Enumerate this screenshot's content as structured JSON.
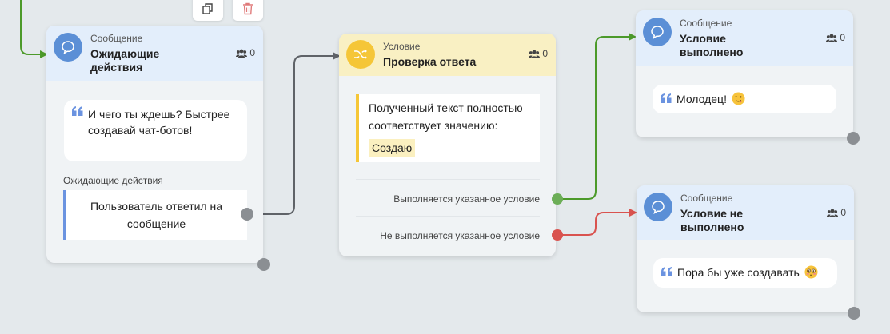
{
  "node_waiting": {
    "kind": "Сообщение",
    "title": "Ожидающие действия",
    "users": "0",
    "message": "И чего ты ждешь? Быстрее создавай чат-ботов!",
    "section_label": "Ожидающие действия",
    "action": "Пользователь ответил на сообщение"
  },
  "node_condition": {
    "kind": "Условие",
    "title": "Проверка ответа",
    "users": "0",
    "condition_text": "Полученный текст полностью соответствует значению:",
    "value": "Создаю",
    "branch_true": "Выполняется указанное условие",
    "branch_false": "Не выполняется указанное условие"
  },
  "node_success": {
    "kind": "Сообщение",
    "title": "Условие выполнено",
    "users": "0",
    "message": "Молодец!",
    "emoji": "winking-face-icon"
  },
  "node_fail": {
    "kind": "Сообщение",
    "title": "Условие не выполнено",
    "users": "0",
    "message": "Пора бы уже создавать",
    "emoji": "flushed-face-icon"
  },
  "colors": {
    "message_header": "#e3eefb",
    "condition_header": "#f9f0c3",
    "message_avatar": "#5b8fd6",
    "condition_avatar": "#f5c637",
    "wire_default": "#5f6368",
    "wire_true": "#4c9a2a",
    "wire_false": "#d9534f",
    "canvas": "#e4e9ec"
  }
}
